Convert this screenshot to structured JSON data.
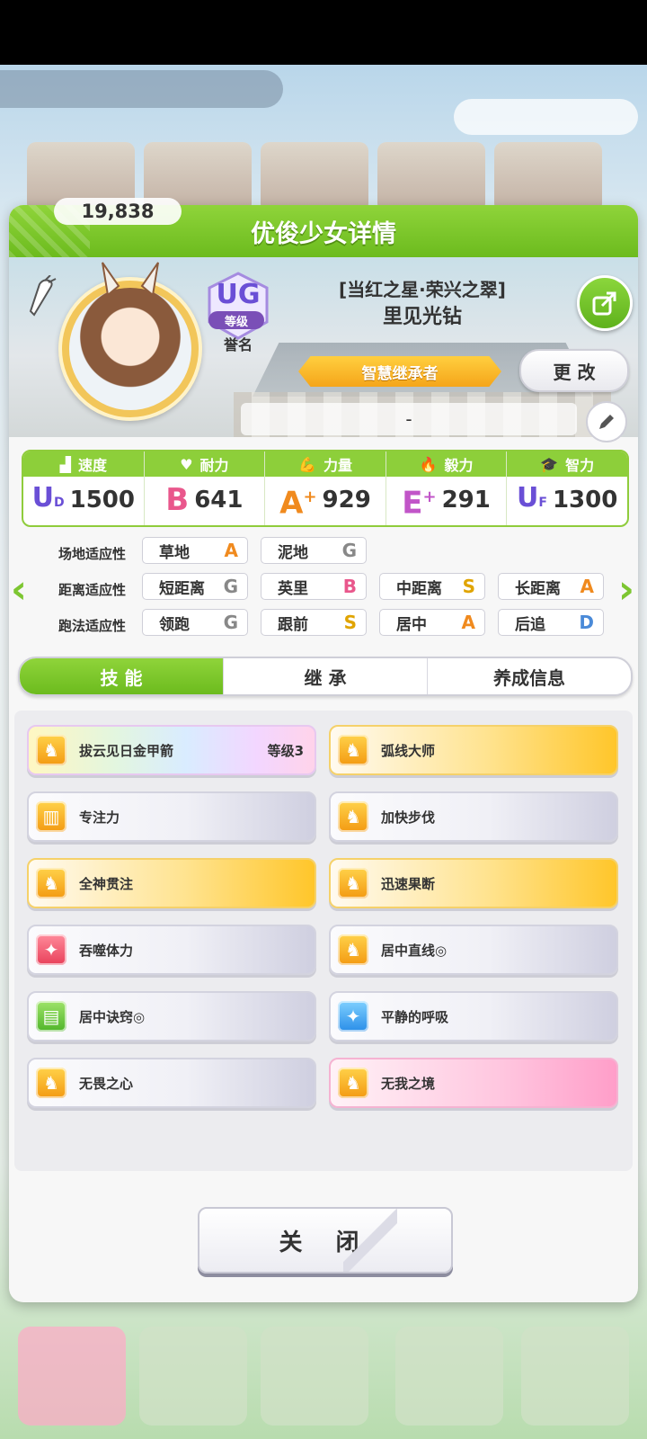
{
  "dialog": {
    "title": "优俊少女详情",
    "close_label": "关 闭"
  },
  "profile": {
    "fans": "19,838",
    "rank": "UG",
    "rank_label": "等级",
    "honor_label": "誉名",
    "title": "[当红之星·荣兴之翠]",
    "name": "里见光钻",
    "inheritor": "智慧继承者",
    "change_label": "更 改",
    "comment": "-"
  },
  "stats": [
    {
      "label": "速度",
      "grade": "U",
      "grade_sub": "D",
      "value": "1500",
      "icon": "shoe-icon"
    },
    {
      "label": "耐力",
      "grade": "B",
      "grade_sub": "",
      "value": "641",
      "icon": "heart-icon"
    },
    {
      "label": "力量",
      "grade": "A",
      "grade_sub": "+",
      "value": "929",
      "icon": "muscle-icon"
    },
    {
      "label": "毅力",
      "grade": "E",
      "grade_sub": "+",
      "value": "291",
      "icon": "flame-icon"
    },
    {
      "label": "智力",
      "grade": "U",
      "grade_sub": "F",
      "value": "1300",
      "icon": "graduation-cap-icon"
    }
  ],
  "aptitude": {
    "track_label": "场地适应性",
    "distance_label": "距离适应性",
    "strategy_label": "跑法适应性",
    "track": [
      {
        "name": "草地",
        "grade": "A"
      },
      {
        "name": "泥地",
        "grade": "G"
      }
    ],
    "distance": [
      {
        "name": "短距离",
        "grade": "G"
      },
      {
        "name": "英里",
        "grade": "B"
      },
      {
        "name": "中距离",
        "grade": "S"
      },
      {
        "name": "长距离",
        "grade": "A"
      }
    ],
    "strategy": [
      {
        "name": "领跑",
        "grade": "G"
      },
      {
        "name": "跟前",
        "grade": "S"
      },
      {
        "name": "居中",
        "grade": "A"
      },
      {
        "name": "后追",
        "grade": "D"
      }
    ]
  },
  "tabs": [
    "技 能",
    "继 承",
    "养成信息"
  ],
  "skills": [
    {
      "name": "拔云见日金甲箭",
      "level": "等级3",
      "style": "rainbow",
      "icon": "running-horse-icon"
    },
    {
      "name": "弧线大师",
      "level": "",
      "style": "gold",
      "icon": "running-horse-icon"
    },
    {
      "name": "专注力",
      "level": "",
      "style": "gray",
      "icon": "gate-icon"
    },
    {
      "name": "加快步伐",
      "level": "",
      "style": "gray",
      "icon": "running-horse-icon"
    },
    {
      "name": "全神贯注",
      "level": "",
      "style": "gold",
      "icon": "running-horse-icon"
    },
    {
      "name": "迅速果断",
      "level": "",
      "style": "gold",
      "icon": "running-horse-icon"
    },
    {
      "name": "吞噬体力",
      "level": "",
      "style": "gray",
      "icon": "sparkle-red-icon"
    },
    {
      "name": "居中直线◎",
      "level": "",
      "style": "gray",
      "icon": "running-horse-icon"
    },
    {
      "name": "居中诀窍◎",
      "level": "",
      "style": "gray",
      "icon": "book-icon"
    },
    {
      "name": "平静的呼吸",
      "level": "",
      "style": "gray",
      "icon": "sparkle-blue-icon"
    },
    {
      "name": "无畏之心",
      "level": "",
      "style": "gray",
      "icon": "running-horse-icon"
    },
    {
      "name": "无我之境",
      "level": "",
      "style": "pink",
      "icon": "running-horse-icon"
    }
  ]
}
